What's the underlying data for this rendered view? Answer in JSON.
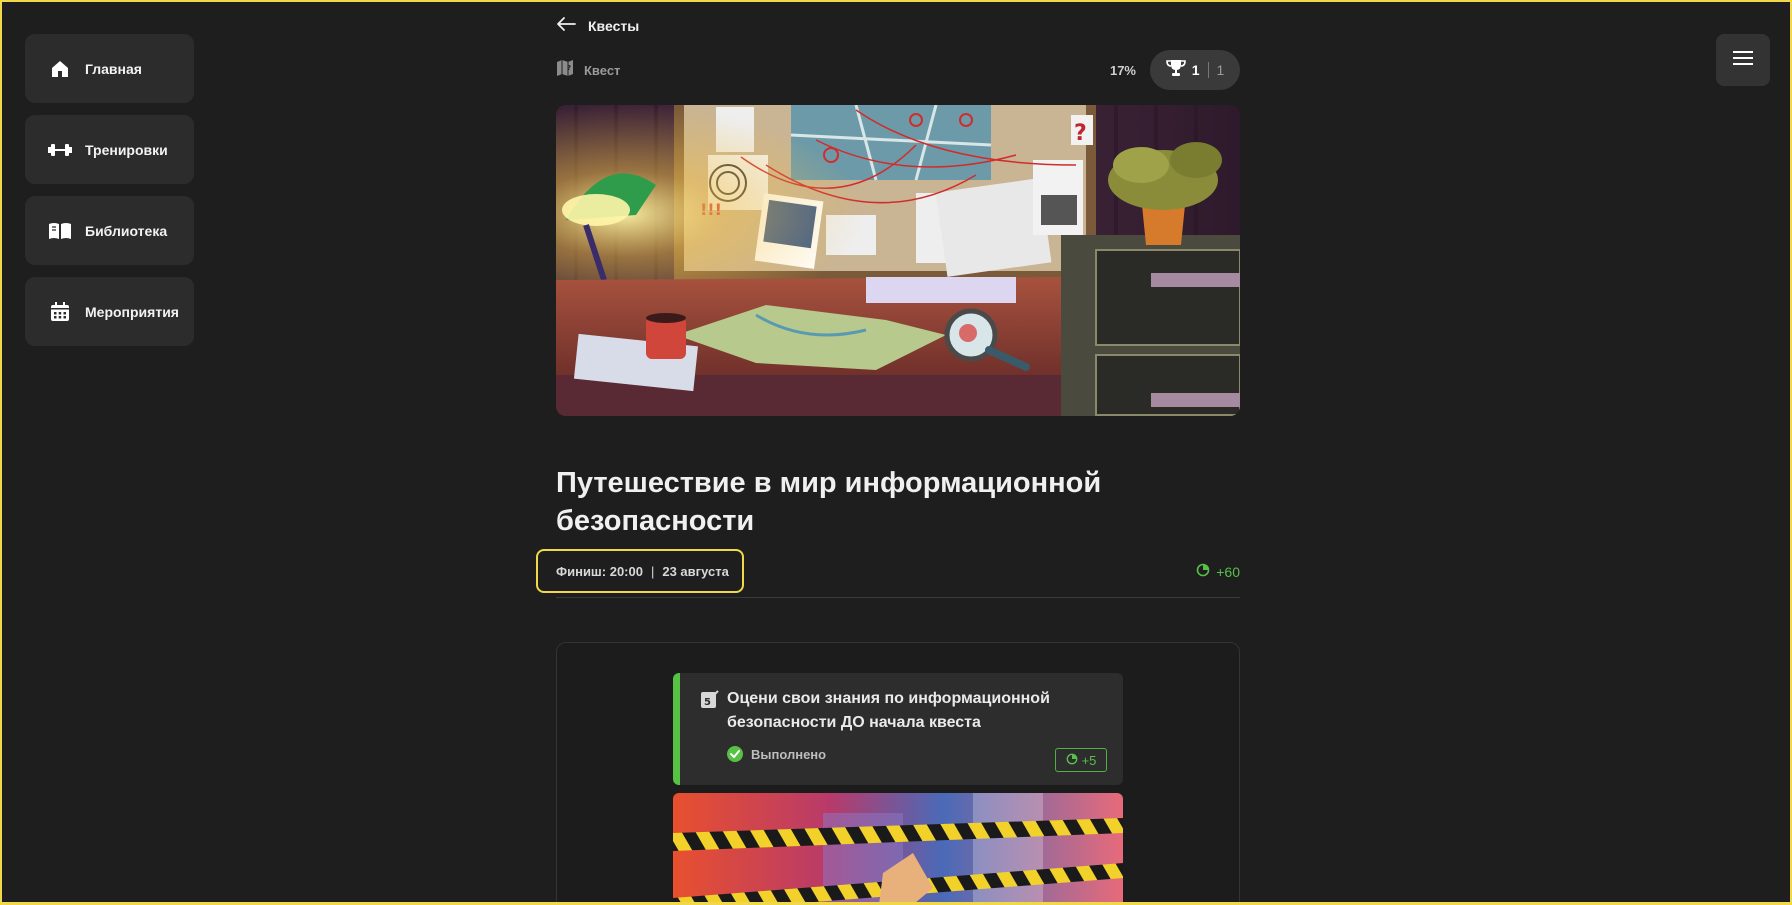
{
  "sidebar": {
    "items": [
      {
        "label": "Главная",
        "icon": "home-icon"
      },
      {
        "label": "Тренировки",
        "icon": "dumbbell-icon"
      },
      {
        "label": "Библиотека",
        "icon": "book-icon"
      },
      {
        "label": "Мероприятия",
        "icon": "calendar-icon"
      }
    ]
  },
  "header": {
    "back_label": "Квесты"
  },
  "quest": {
    "type_label": "Квест",
    "progress": "17%",
    "trophies_earned": "1",
    "trophies_total": "1",
    "title": "Путешествие в мир информационной безопасности",
    "finish_label": "Финиш: 20:00",
    "finish_date": "23 августа",
    "points": "+60"
  },
  "task": {
    "title": "Оцени свои знания по информационной безопасности ДО начала квеста",
    "status": "Выполнено",
    "points": "+5"
  },
  "colors": {
    "accent_green": "#57c144",
    "highlight_yellow": "#f0d84a",
    "background": "#1e1e1e"
  }
}
